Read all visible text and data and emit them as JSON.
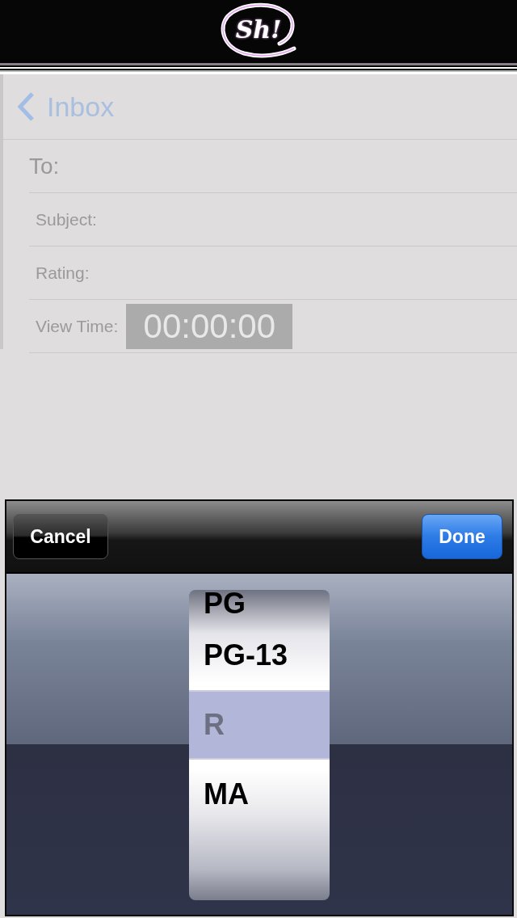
{
  "header": {
    "logo": "Sh!"
  },
  "nav": {
    "back_label": "Inbox"
  },
  "form": {
    "fields": [
      {
        "kind": "text",
        "label": "To:"
      },
      {
        "kind": "text",
        "label": "Subject:"
      },
      {
        "kind": "text",
        "label": "Rating:"
      },
      {
        "kind": "time",
        "label": "View Time:",
        "value": "00:00:00"
      }
    ]
  },
  "picker": {
    "cancel": "Cancel",
    "done": "Done",
    "options": [
      {
        "label": "PG",
        "selected": false
      },
      {
        "label": "PG-13",
        "selected": false
      },
      {
        "label": "R",
        "selected": true
      },
      {
        "label": "MA",
        "selected": false
      }
    ]
  }
}
